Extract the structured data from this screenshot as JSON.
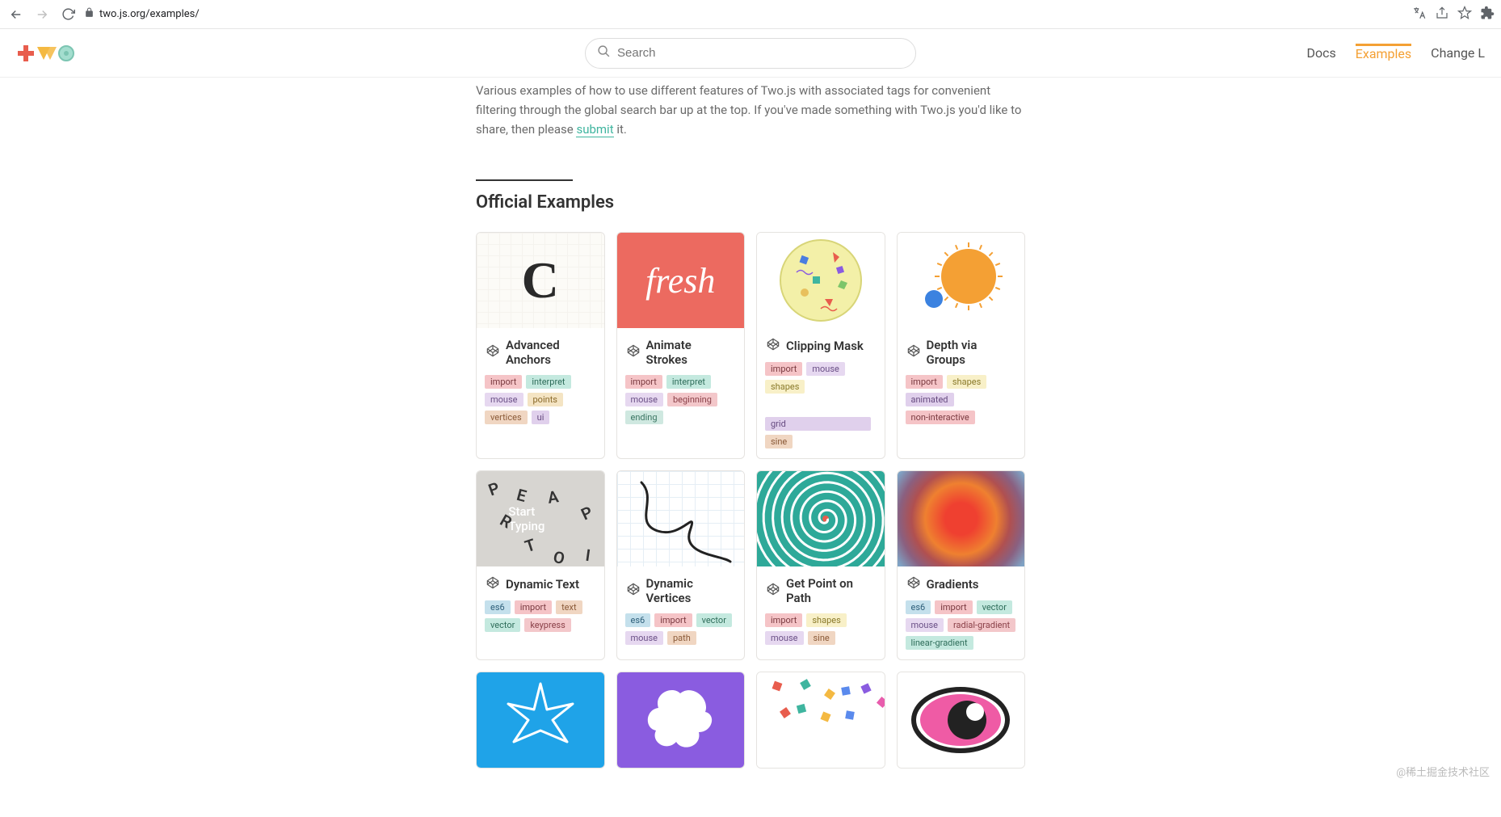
{
  "browser": {
    "url": "two.js.org/examples/"
  },
  "search": {
    "placeholder": "Search"
  },
  "nav": {
    "docs": "Docs",
    "examples": "Examples",
    "changelog": "Change L"
  },
  "intro": {
    "text1": "Various examples of how to use different features of Two.js with associated tags for convenient filtering through the global search bar up at the top. If you've made something with Two.js you'd like to share, then please ",
    "link": "submit",
    "text2": " it."
  },
  "section_title": "Official Examples",
  "cards": [
    {
      "title": "Advanced Anchors",
      "tags": [
        "import",
        "interpret",
        "mouse",
        "points",
        "vertices",
        "ui"
      ],
      "thumb": "t1"
    },
    {
      "title": "Animate Strokes",
      "tags": [
        "import",
        "interpret",
        "mouse",
        "beginning",
        "ending"
      ],
      "thumb": "t2"
    },
    {
      "title": "Clipping Mask",
      "tags": [
        "import",
        "mouse",
        "shapes",
        "grid",
        "sine"
      ],
      "thumb": "t3"
    },
    {
      "title": "Depth via Groups",
      "tags": [
        "import",
        "shapes",
        "animated",
        "non-interactive"
      ],
      "thumb": "t4"
    },
    {
      "title": "Dynamic Text",
      "tags": [
        "es6",
        "import",
        "text",
        "vector",
        "keypress"
      ],
      "thumb": "t5"
    },
    {
      "title": "Dynamic Vertices",
      "tags": [
        "es6",
        "import",
        "vector",
        "mouse",
        "path"
      ],
      "thumb": "t6"
    },
    {
      "title": "Get Point on Path",
      "tags": [
        "import",
        "shapes",
        "mouse",
        "sine"
      ],
      "thumb": "t7"
    },
    {
      "title": "Gradients",
      "tags": [
        "es6",
        "import",
        "vector",
        "mouse",
        "radial-gradient",
        "linear-gradient"
      ],
      "thumb": "t8"
    },
    {
      "title": "",
      "tags": [],
      "thumb": "t9"
    },
    {
      "title": "",
      "tags": [],
      "thumb": "t10"
    },
    {
      "title": "",
      "tags": [],
      "thumb": "t11"
    },
    {
      "title": "",
      "tags": [],
      "thumb": "t12"
    }
  ],
  "thumb_text": {
    "t1": "C",
    "t2": "fresh",
    "t5_center": "Start Typing"
  },
  "watermark": "@稀土掘金技术社区"
}
